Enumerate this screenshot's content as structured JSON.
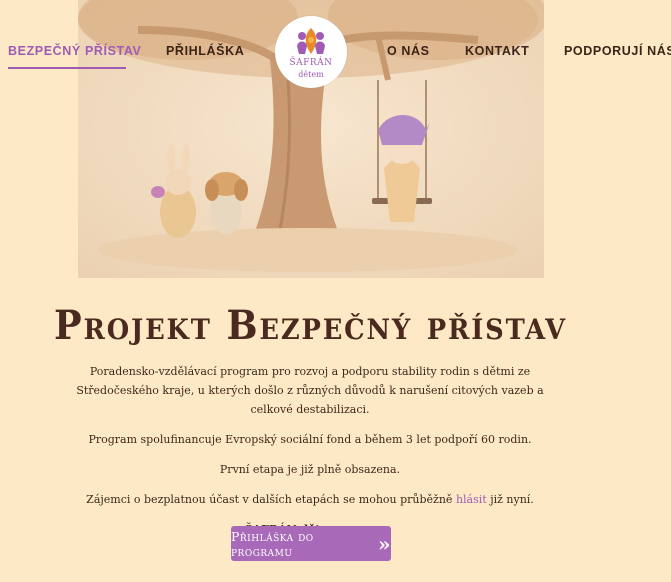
{
  "nav": {
    "items": [
      {
        "label": "BEZPEČNÝ PŘÍSTAV",
        "active": true
      },
      {
        "label": "PŘIHLÁŠKA"
      },
      {
        "label": "O NÁS"
      },
      {
        "label": "KONTAKT"
      },
      {
        "label": "PODPORUJÍ NÁS"
      }
    ]
  },
  "logo": {
    "line1": "ŠAFRÁN",
    "line2": "dětem",
    "icon": "people-family-icon"
  },
  "hero": {
    "icon": "tree-illustration"
  },
  "main": {
    "title": "Projekt Bezpečný přístav",
    "p1": "Poradensko-vzdělávací program pro rozvoj a podporu stability rodin s dětmi ze Středočeského kraje, u kterých došlo z různých důvodů k narušení citových vazeb a celkové destabilizaci.",
    "p2": "Program spolufinancuje Evropský sociální fond a během 3 let podpoří 60 rodin.",
    "p3": "První etapa  je již  plně obsazena.",
    "p4_before": "Zájemci o bezplatnou účast v dalších etapách se mohou průběžně",
    "p4_link": "hlásit",
    "p4_after": "již nyní.",
    "org": "ŠAFRÁN dětem o.p.s.",
    "cta": "Přihláška do programu",
    "cta_icon": "»"
  },
  "colors": {
    "accent": "#a86ab8",
    "background": "#fde9c5",
    "nav_text": "#3a2417"
  }
}
